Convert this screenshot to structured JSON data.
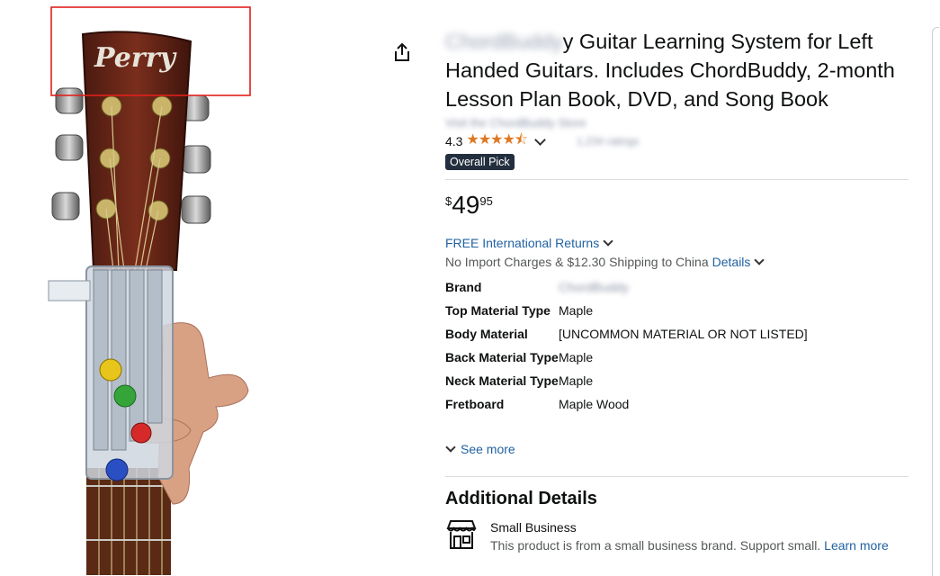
{
  "product": {
    "brand_blurred": "ChordBuddy",
    "title_rest": "y Guitar Learning System for Left Handed Guitars. Includes ChordBuddy, 2-month Lesson Plan Book, DVD, and Song Book",
    "store_link_blurred": "Visit the ChordBuddy Store",
    "rating": "4.3",
    "stars": "★★★★⯪",
    "ratings_count_blurred": "1,234 ratings",
    "badge": "Overall Pick"
  },
  "headstock_logo": "Perry",
  "price": {
    "symbol": "$",
    "whole": "49",
    "fraction": "95"
  },
  "delivery": {
    "returns": "FREE International Returns",
    "shipping": "No Import Charges & $12.30 Shipping to China",
    "details_link": "Details"
  },
  "specs": [
    {
      "key": "Brand",
      "value": "ChordBuddy",
      "blurred": true
    },
    {
      "key": "Top Material Type",
      "value": "Maple"
    },
    {
      "key": "Body Material",
      "value": "[UNCOMMON MATERIAL OR NOT LISTED]"
    },
    {
      "key": "Back Material Type",
      "value": "Maple"
    },
    {
      "key": "Neck Material Type",
      "value": "Maple"
    },
    {
      "key": "Fretboard",
      "value": "Maple Wood"
    }
  ],
  "see_more": "See more",
  "additional": {
    "title": "Additional Details",
    "small_business": "Small Business",
    "description": "This product is from a small business brand. Support small.",
    "learn_more": "Learn more"
  },
  "colors": {
    "link": "#2162a1",
    "star": "#de7921",
    "badge_bg": "#232f3e",
    "highlight_box": "#e0201c"
  }
}
